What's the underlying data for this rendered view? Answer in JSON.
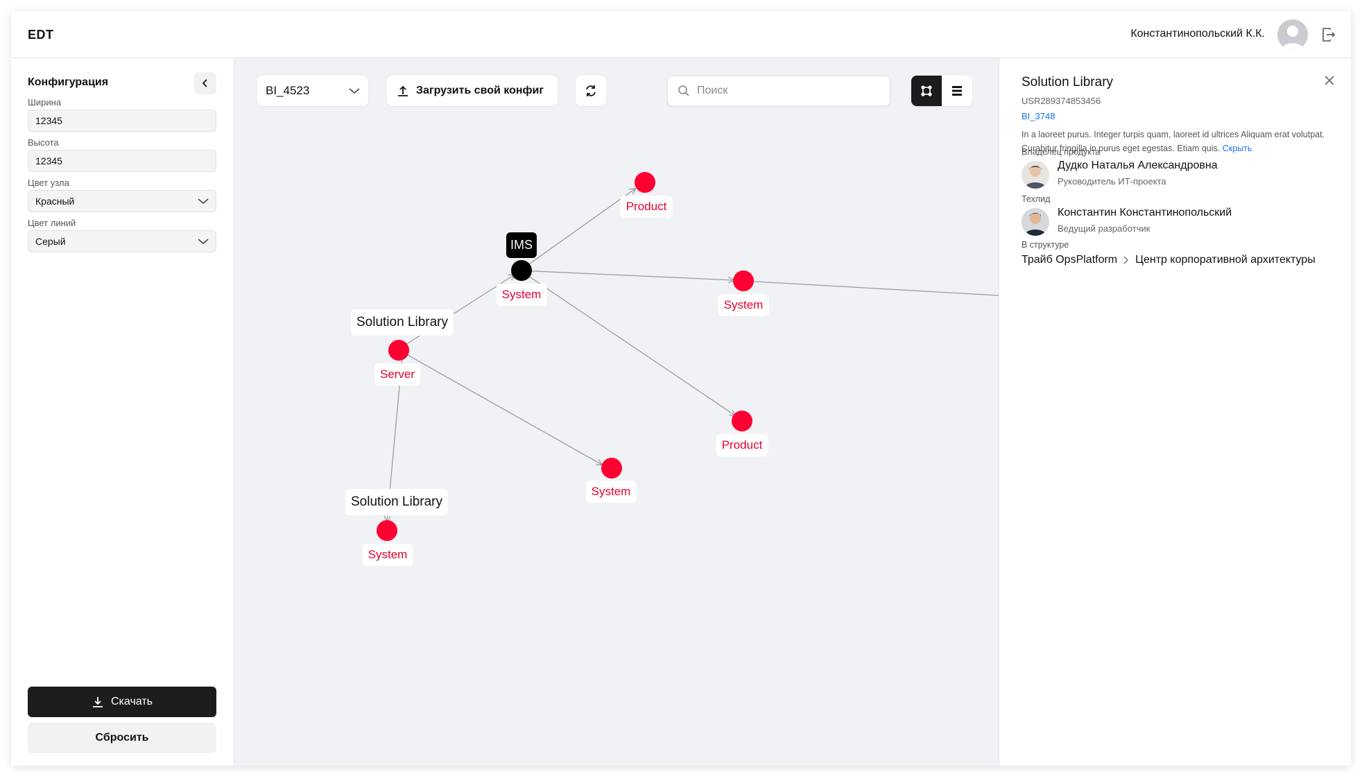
{
  "header": {
    "logo": "EDT",
    "user_name": "Константинопольский К.К."
  },
  "left_panel": {
    "title": "Конфигурация",
    "fields": {
      "width_label": "Ширина",
      "width_value": "12345",
      "height_label": "Высота",
      "height_value": "12345",
      "node_color_label": "Цвет узла",
      "node_color_value": "Красный",
      "line_color_label": "Цвет линий",
      "line_color_value": "Серый"
    },
    "download_label": "Скачать",
    "reset_label": "Сбросить"
  },
  "toolbar": {
    "config_select": "BI_4523",
    "upload_label": "Загрузить свой конфиг",
    "search_placeholder": "Поиск"
  },
  "graph": {
    "nodes": [
      {
        "id": "n-product-top",
        "label": "Product",
        "color": "#ff0033"
      },
      {
        "id": "n-ims",
        "label": "System",
        "badge": "IMS",
        "color": "#000000"
      },
      {
        "id": "n-system-right",
        "label": "System",
        "color": "#ff0033"
      },
      {
        "id": "n-server",
        "label": "Server",
        "title": "Solution Library",
        "color": "#ff0033"
      },
      {
        "id": "n-product-bottom",
        "label": "Product",
        "color": "#ff0033"
      },
      {
        "id": "n-system-mid",
        "label": "System",
        "color": "#ff0033"
      },
      {
        "id": "n-system-bottom",
        "label": "System",
        "title": "Solution Library",
        "color": "#ff0033"
      }
    ],
    "edge_color": "#9a9da3"
  },
  "details": {
    "title": "Solution Library",
    "id": "USR289374853456",
    "link": "BI_3748",
    "description": "In a laoreet purus. Integer turpis quam, laoreet id ultrices Aliquam erat volutpat. Curabitur fringilla in purus eget egestas. Etiam quis.",
    "hide_link": "Скрыть",
    "owner_label": "Владелец продукта",
    "owner_name": "Дудко Наталья Александровна",
    "owner_role": "Руководитель ИТ-проекта",
    "tech_label": "Техлид",
    "tech_name": "Константин Константинопольский",
    "tech_role": "Ведущий разработчик",
    "structure_label": "В структуре",
    "structure_path": [
      "Трайб OpsPlatform",
      "Центр корпоративной архитектуры"
    ]
  },
  "colors": {
    "accent_red": "#ff0033",
    "label_red": "#e6002e",
    "dark": "#1b1c1e",
    "link_blue": "#1a73e8"
  }
}
